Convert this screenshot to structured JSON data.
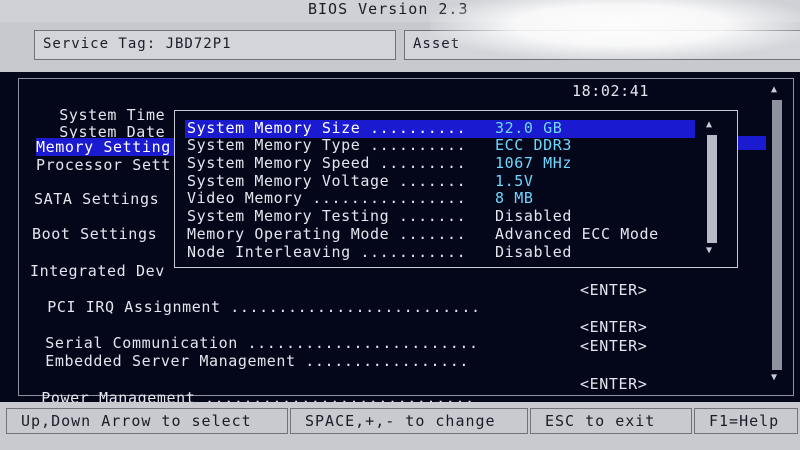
{
  "title_bar": {
    "title": "BIOS Version 2.3"
  },
  "tags": {
    "service_tag": "Service Tag: JBD72P1",
    "asset_tag": "Asset"
  },
  "main_menu": {
    "system_time": {
      "label": "System Time ......................................",
      "value": "18:02:41"
    },
    "system_date": {
      "label": "System Date .."
    },
    "memory_settings": "Memory Setting",
    "processor_settings": "Processor Sett",
    "sata_settings": "SATA Settings",
    "boot_settings": "Boot Settings",
    "integrated_devices": "Integrated Dev",
    "pci_irq": {
      "label": "PCI IRQ Assignment ..........................",
      "value": "<ENTER>"
    },
    "serial_comm": {
      "label": "Serial Communication ........................",
      "value": "<ENTER>"
    },
    "embedded_server_mgmt": {
      "label": "Embedded Server Management .................",
      "value": "<ENTER>"
    },
    "power_mgmt": {
      "label": "Power Management ............................",
      "value": "<ENTER>"
    }
  },
  "memory_popup": {
    "rows": [
      {
        "label": "System Memory Size ..........",
        "value": "32.0 GB"
      },
      {
        "label": "System Memory Type ..........",
        "value": "ECC DDR3"
      },
      {
        "label": "System Memory Speed .........",
        "value": "1067 MHz"
      },
      {
        "label": "System Memory Voltage .......",
        "value": "1.5V"
      },
      {
        "label": "Video Memory ................",
        "value": "8 MB"
      },
      {
        "label": "System Memory Testing .......",
        "value": "Disabled"
      },
      {
        "label": "Memory Operating Mode .......",
        "value": "Advanced ECC Mode"
      },
      {
        "label": "Node Interleaving ...........",
        "value": "Disabled"
      }
    ]
  },
  "status_bar": {
    "nav_hint": "Up,Down Arrow to select",
    "change_hint": "SPACE,+,- to change",
    "exit_hint": "ESC to exit",
    "help_hint": "F1=Help"
  },
  "icons": {
    "scroll_up": "▲",
    "scroll_down": "▼"
  },
  "colors": {
    "background": "#04061a",
    "highlight": "#1a1ad0",
    "value_cyan": "#6fd8ff",
    "bar_gray": "#c8cad0"
  }
}
